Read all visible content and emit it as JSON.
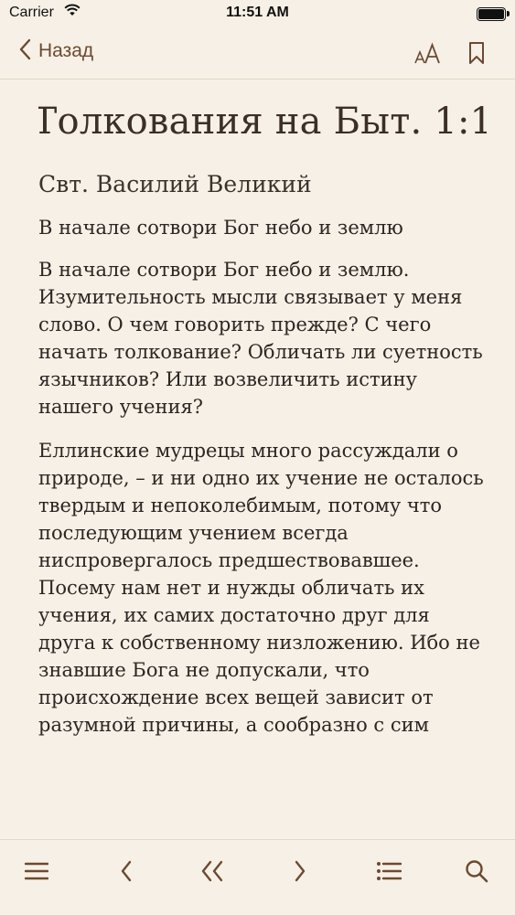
{
  "status_bar": {
    "carrier": "Carrier",
    "time": "11:51 AM"
  },
  "nav": {
    "back_label": "Назад"
  },
  "article": {
    "title": "Толкования на Быт. 1:1",
    "author": "Свт. Василий Великий",
    "verse": "В начале сотвори Бог небо и землю",
    "paragraph1_lead": "В начале сотвори Бог небо и землю.",
    "paragraph1_rest": " Изумительность мысли связывает у меня слово. О чем говорить прежде? С чего начать толкование? Обличать ли суетность язычников? Или возвеличить истину нашего учения?",
    "paragraph2": "Еллинские мудрецы много рассуждали о природе, – и ни одно их учение не осталось твердым и непоколебимым, потому что последующим учением всегда ниспровергалось предшествовавшее. Посему нам нет и нужды обличать их учения, их самих достаточно друг для друга к собственному низложению. Ибо не знавшие Бога не допускали, что происхождение всех вещей зависит от разумной причины, а сообразно с сим"
  },
  "colors": {
    "background": "#f7f0e6",
    "accent": "#6b4a32",
    "text": "#2b2623"
  },
  "toolbar_icons": [
    "menu-icon",
    "chevron-left-icon",
    "double-chevron-left-icon",
    "chevron-right-icon",
    "list-icon",
    "search-icon"
  ]
}
